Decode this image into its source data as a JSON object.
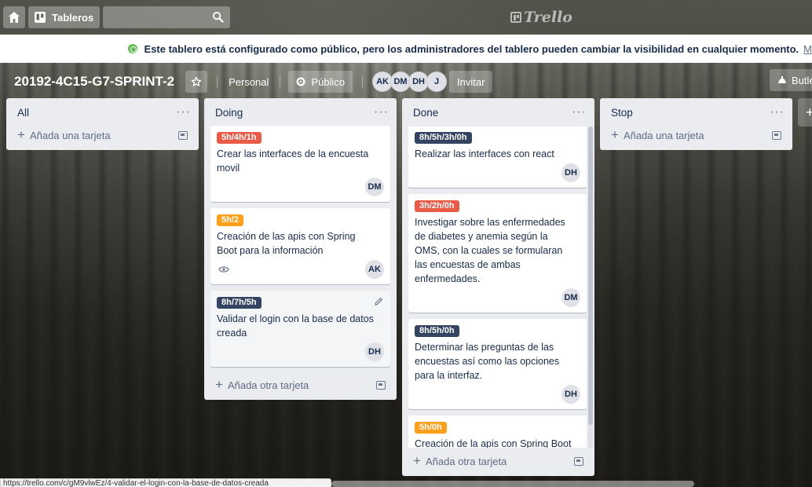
{
  "topbar": {
    "home_icon": "home-icon",
    "boards_label": "Tableros",
    "search_placeholder": "",
    "logo_text": "Trello"
  },
  "banner": {
    "text": "Este tablero está configurado como público, pero los administradores del tablero pueden cambiar la visibilidad en cualquier momento.",
    "more_text": "M"
  },
  "board": {
    "title": "20192-4C15-G7-SPRINT-2",
    "team_label": "Personal",
    "visibility_label": "Público",
    "members": [
      "AK",
      "DM",
      "DH",
      "J"
    ],
    "invite_label": "Invitar",
    "butler_label": "Butler"
  },
  "lists": [
    {
      "title": "All",
      "cards": [],
      "add_label": "Añada una tarjeta"
    },
    {
      "title": "Doing",
      "cards": [
        {
          "label": "5h/4h/1h",
          "label_color": "#eb5a46",
          "text": "Crear las interfaces de la encuesta movil",
          "member": "DM"
        },
        {
          "label": "5h/2",
          "label_color": "#ff9f1a",
          "text": "Creación de las apis con Spring Boot para la información",
          "member": "AK",
          "watch": true
        },
        {
          "label": "8h/7h/5h",
          "label_color": "#344563",
          "text": "Validar el login con la base de datos creada",
          "member": "DH"
        }
      ],
      "add_label": "Añada otra tarjeta"
    },
    {
      "title": "Done",
      "cards": [
        {
          "label": "8h/5h/3h/0h",
          "label_color": "#344563",
          "text": "Realizar las interfaces con react",
          "member": "DH"
        },
        {
          "label": "3h/2h/0h",
          "label_color": "#eb5a46",
          "text": "Investigar sobre las enfermedades de diabetes y anemia según la OMS, con la cuales se formularan las encuestas de ambas enfermedades.",
          "member": "DM"
        },
        {
          "label": "8h/5h/0h",
          "label_color": "#344563",
          "text": "Determinar las preguntas de las encuestas así como las opciones para la interfaz.",
          "member": "DH"
        },
        {
          "label": "5h/0h",
          "label_color": "#ff9f1a",
          "text": "Creación de la apis con Spring Boot para los usuarios",
          "member": ""
        }
      ],
      "add_label": "Añada otra tarjeta"
    },
    {
      "title": "Stop",
      "cards": [],
      "add_label": "Añada una tarjeta"
    }
  ],
  "status_bar": {
    "url": "https://trello.com/c/gM9vlwEz/4-validar-el-login-con-la-base-de-datos-creada"
  },
  "colors": {
    "red_label": "#eb5a46",
    "orange_label": "#ff9f1a",
    "dark_label": "#344563",
    "list_bg": "#ebecf0"
  }
}
